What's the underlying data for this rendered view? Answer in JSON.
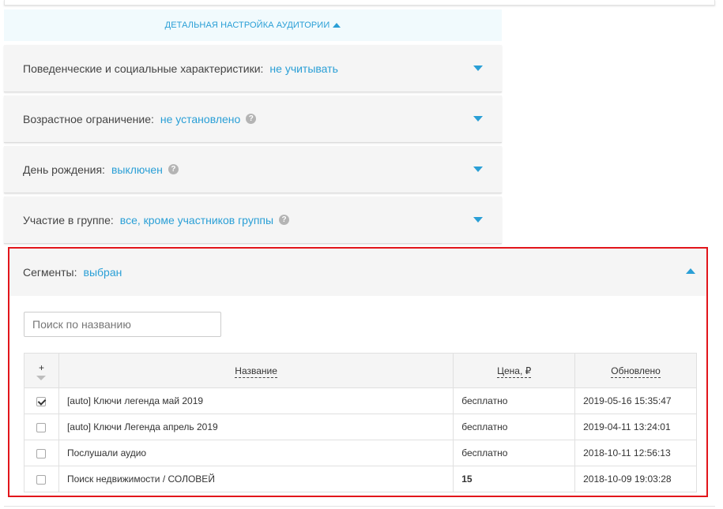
{
  "detail_toggle": {
    "label": "ДЕТАЛЬНАЯ НАСТРОЙКА АУДИТОРИИ"
  },
  "panels": [
    {
      "label": "Поведенческие и социальные характеристики:",
      "value": "не учитывать"
    },
    {
      "label": "Возрастное ограничение:",
      "value": "не установлено"
    },
    {
      "label": "День рождения:",
      "value": "выключен"
    },
    {
      "label": "Участие в группе:",
      "value": "все, кроме участников группы"
    }
  ],
  "segments": {
    "label": "Сегменты:",
    "value": "выбран",
    "search_placeholder": "Поиск по названию",
    "columns": {
      "select": "+",
      "name": "Название",
      "price": "Цена, ₽",
      "updated": "Обновлено"
    },
    "rows": [
      {
        "checked": true,
        "name": "[auto] Ключи легенда май 2019",
        "price": "бесплатно",
        "updated": "2019-05-16 15:35:47"
      },
      {
        "checked": false,
        "name": "[auto] Ключи Легенда апрель 2019",
        "price": "бесплатно",
        "updated": "2019-04-11 13:24:01"
      },
      {
        "checked": false,
        "name": "Послушали аудио",
        "price": "бесплатно",
        "updated": "2018-10-11 12:56:13"
      },
      {
        "checked": false,
        "name": "Поиск недвижимости / СОЛОВЕЙ",
        "price": "15",
        "updated": "2018-10-09 19:03:28"
      }
    ]
  },
  "colors": {
    "accent": "#2a9fd6",
    "highlight_border": "#e2151b",
    "paid_price": "#2eaa2e"
  },
  "icons": {
    "help": "question-circle-icon",
    "expand": "caret-down-icon",
    "collapse": "caret-up-icon"
  }
}
